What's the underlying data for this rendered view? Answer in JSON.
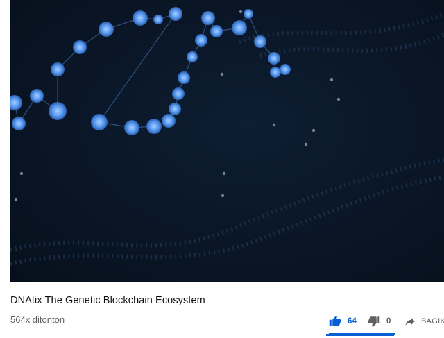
{
  "video": {
    "title": "DNAtix The Genetic Blockchain Ecosystem",
    "views": "564x ditonton"
  },
  "actions": {
    "like_count": "64",
    "dislike_count": "0",
    "share_label": "BAGIKAN"
  },
  "colors": {
    "accent": "#065fd4",
    "player_bg": "#0a1626",
    "node_blue": "#5a9cf2"
  },
  "icons": {
    "like": "thumb-up-icon",
    "dislike": "thumb-down-icon",
    "share": "share-arrow-icon"
  }
}
